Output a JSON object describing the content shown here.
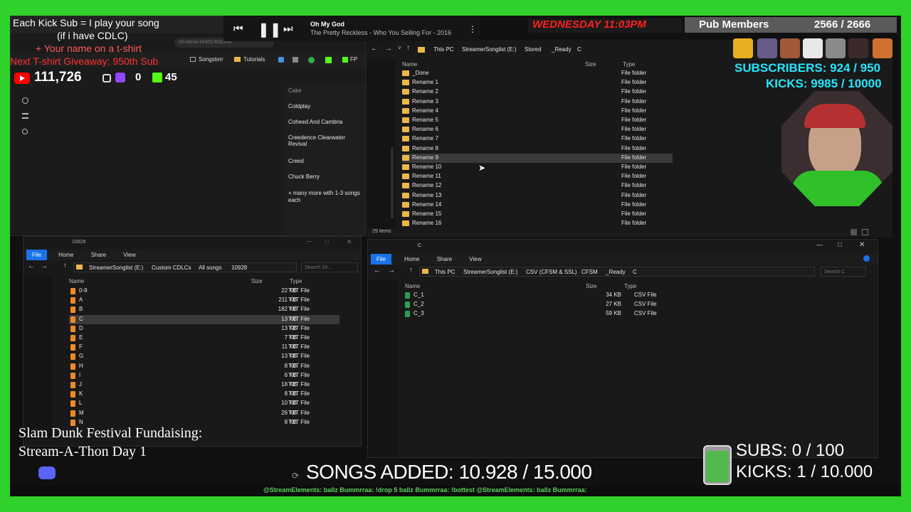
{
  "overlay": {
    "kick_sub_line1": "Each Kick Sub = I play your song",
    "kick_sub_line2": "(if i have CDLC)",
    "name_tshirt": "+ Your name on a t-shirt",
    "giveaway": "Next T-shirt Giveaway: 950th Sub",
    "yt_count": "111,726",
    "ig_count": "0",
    "kick_count": "45",
    "slam_dunk_line1": "Slam Dunk Festival Fundaising:",
    "slam_dunk_line2": "Stream-A-Thon Day 1",
    "songs_added": "SONGS ADDED: 10.928 / 15.000",
    "subs_goal": "SUBS:  0 / 100",
    "kicks_goal": "KICKS: 1 / 10.000",
    "clock": "WEDNESDAY 11:03PM",
    "pub_members_label": "Pub Members",
    "pub_members_count": "2566 / 2666",
    "subscribers": "SUBSCRIBERS: 924 / 950",
    "kicks_top": "KICKS: 9985 / 10000",
    "ticker": "@StreamElements: ballz  Bummrraa: !drop 5 ballz  Bummrraa: !bottest  @StreamElements: ballz  Bummrraa:"
  },
  "player": {
    "song_title": "Oh My God",
    "song_artist": "The Pretty Reckless - Who You Selling For - 2016"
  },
  "browser": {
    "tabs": [
      "Songsterr",
      "Tutorials",
      "FP"
    ],
    "url_fragment": "cfc-be3a-2e401403ce4c"
  },
  "songlist": {
    "items": [
      "Cake",
      "Coldplay",
      "Coheed And Cambria",
      "Creedence Clearwater Revival",
      "Creed",
      "Chuck Berry"
    ],
    "more": "+ many more with 1-3 songs each"
  },
  "top_explorer": {
    "breadcrumb": [
      "This PC",
      "StreamerSonglist (E:)",
      "Stored",
      "_Ready",
      "C"
    ],
    "columns": {
      "name": "Name",
      "size": "Size",
      "type": "Type"
    },
    "rows": [
      {
        "name": "_Done",
        "type": "File folder"
      },
      {
        "name": "Rename 1",
        "type": "File folder"
      },
      {
        "name": "Rename 2",
        "type": "File folder"
      },
      {
        "name": "Rename 3",
        "type": "File folder"
      },
      {
        "name": "Rename 4",
        "type": "File folder"
      },
      {
        "name": "Rename 5",
        "type": "File folder"
      },
      {
        "name": "Rename 6",
        "type": "File folder"
      },
      {
        "name": "Rename 7",
        "type": "File folder"
      },
      {
        "name": "Rename 8",
        "type": "File folder"
      },
      {
        "name": "Rename 9",
        "type": "File folder"
      },
      {
        "name": "Rename 10",
        "type": "File folder"
      },
      {
        "name": "Rename 11",
        "type": "File folder"
      },
      {
        "name": "Rename 12",
        "type": "File folder"
      },
      {
        "name": "Rename 13",
        "type": "File folder"
      },
      {
        "name": "Rename 14",
        "type": "File folder"
      },
      {
        "name": "Rename 15",
        "type": "File folder"
      },
      {
        "name": "Rename 16",
        "type": "File folder"
      }
    ],
    "selected_row": "Rename 9",
    "status": "29 items"
  },
  "left_explorer": {
    "title": "10928",
    "ribbon": [
      "File",
      "Home",
      "Share",
      "View"
    ],
    "breadcrumb": [
      "StreamerSonglist (E:)",
      "Custom CDLCs",
      "All songs",
      "10928"
    ],
    "search_placeholder": "Search 10...",
    "columns": {
      "name": "Name",
      "size": "Size",
      "type": "Type"
    },
    "rows": [
      {
        "name": "0-9",
        "size": "22 KB",
        "type": "TXT File"
      },
      {
        "name": "A",
        "size": "211 KB",
        "type": "TXT File"
      },
      {
        "name": "B",
        "size": "182 KB",
        "type": "TXT File"
      },
      {
        "name": "C",
        "size": "13 KB",
        "type": "TXT File"
      },
      {
        "name": "D",
        "size": "13 KB",
        "type": "TXT File"
      },
      {
        "name": "E",
        "size": "7 KB",
        "type": "TXT File"
      },
      {
        "name": "F",
        "size": "11 KB",
        "type": "TXT File"
      },
      {
        "name": "G",
        "size": "13 KB",
        "type": "TXT File"
      },
      {
        "name": "H",
        "size": "8 KB",
        "type": "TXT File"
      },
      {
        "name": "I",
        "size": "6 KB",
        "type": "TXT File"
      },
      {
        "name": "J",
        "size": "18 KB",
        "type": "TXT File"
      },
      {
        "name": "K",
        "size": "8 KB",
        "type": "TXT File"
      },
      {
        "name": "L",
        "size": "10 KB",
        "type": "TXT File"
      },
      {
        "name": "M",
        "size": "26 KB",
        "type": "TXT File"
      },
      {
        "name": "N",
        "size": "8 KB",
        "type": "TXT File"
      }
    ],
    "selected_row": "C"
  },
  "right_explorer": {
    "title": "C",
    "ribbon": [
      "File",
      "Home",
      "Share",
      "View"
    ],
    "breadcrumb": [
      "This PC",
      "StreamerSonglist (E:)",
      "CSV (CFSM & SSL)",
      "CFSM",
      "_Ready",
      "C"
    ],
    "search_placeholder": "Search C",
    "columns": {
      "name": "Name",
      "size": "Size",
      "type": "Type"
    },
    "rows": [
      {
        "name": "C_1",
        "size": "34 KB",
        "type": "CSV File"
      },
      {
        "name": "C_2",
        "size": "27 KB",
        "type": "CSV File"
      },
      {
        "name": "C_3",
        "size": "59 KB",
        "type": "CSV File"
      }
    ]
  },
  "colors": {
    "green_screen": "#2fd12a",
    "folder": "#e9b84a",
    "txt_icon": "#f08a24",
    "csv_icon": "#2e9e52",
    "accent_blue": "#1a73e8",
    "clock_red": "#ff2020",
    "giveaway_red": "#ff3030",
    "subs_cyan": "#25e6ff"
  }
}
